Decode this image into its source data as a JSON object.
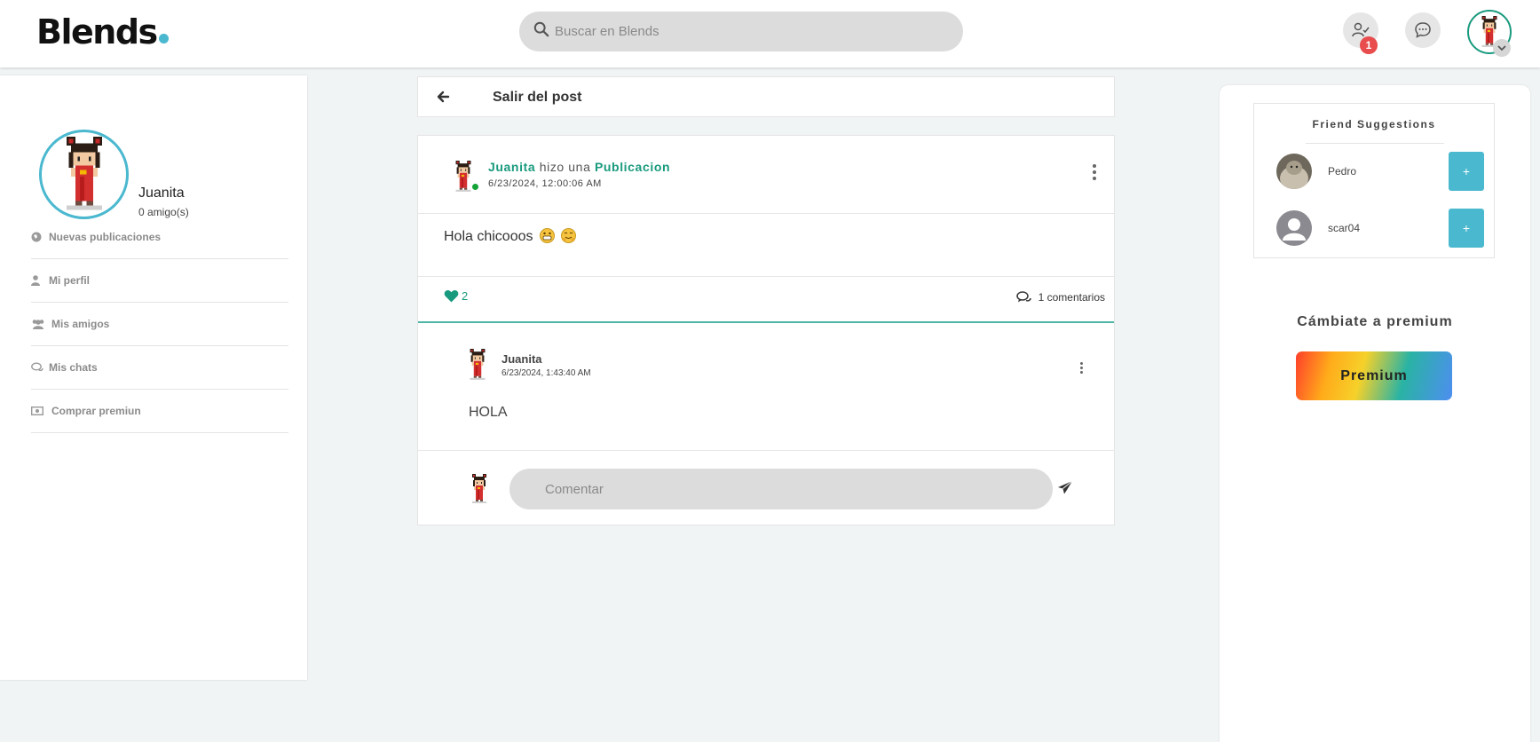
{
  "header": {
    "logo": "Blends",
    "search_placeholder": "Buscar en Blends",
    "friend_requests_count": "1"
  },
  "sidebar": {
    "user_name": "Juanita",
    "friends_text": "0 amigo(s)",
    "items": [
      {
        "label": "Nuevas publicaciones",
        "icon": "globe-icon"
      },
      {
        "label": "Mi perfil",
        "icon": "user-icon"
      },
      {
        "label": "Mis amigos",
        "icon": "users-icon"
      },
      {
        "label": "Mis chats",
        "icon": "chat-icon"
      },
      {
        "label": "Comprar premiun",
        "icon": "money-icon"
      }
    ]
  },
  "backbar": {
    "title": "Salir del post"
  },
  "post": {
    "author": "Juanita",
    "action": "hizo una",
    "type": "Publicacion",
    "date": "6/23/2024, 12:00:06 AM",
    "text": "Hola chicooos",
    "likes": "2",
    "comments_count": "1 comentarios"
  },
  "comment": {
    "author": "Juanita",
    "date": "6/23/2024, 1:43:40 AM",
    "text": "HOLA"
  },
  "composer": {
    "placeholder": "Comentar"
  },
  "suggestions": {
    "title": "Friend Suggestions",
    "people": [
      {
        "name": "Pedro",
        "add_label": "+"
      },
      {
        "name": "scar04",
        "add_label": "+"
      }
    ]
  },
  "premium": {
    "title": "Cámbiate a premium",
    "button_label": "Premium"
  },
  "colors": {
    "accent_teal": "#4ab8cf",
    "brand_green": "#199a7e",
    "badge_red": "#e84c4c"
  }
}
